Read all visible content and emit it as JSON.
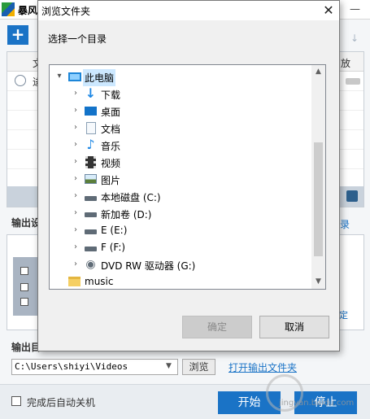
{
  "app": {
    "title": "暴风",
    "table_headers": [
      "文",
      "放"
    ],
    "first_cell": "进",
    "output_settings_label": "输出设",
    "right_link_top": "录",
    "right_link_bottom": "定",
    "output_dir_label": "输出目",
    "output_path": "C:\\Users\\shiyi\\Videos",
    "browse_label": "浏览",
    "open_folder_link": "打开输出文件夹",
    "shutdown_label": "完成后自动关机",
    "start_label": "开始",
    "stop_label": "停止"
  },
  "watermark": {
    "text": "jingyan.baidu.com"
  },
  "dialog": {
    "title": "浏览文件夹",
    "close_glyph": "✕",
    "prompt": "选择一个目录",
    "ok_label": "确定",
    "cancel_label": "取消",
    "tree": [
      {
        "label": "此电脑",
        "icon": "computer-icon",
        "expander": "▾",
        "selected": true
      },
      {
        "label": "下载",
        "icon": "download-folder-icon",
        "expander": "›"
      },
      {
        "label": "桌面",
        "icon": "desktop-folder-icon",
        "expander": "›"
      },
      {
        "label": "文档",
        "icon": "documents-folder-icon",
        "expander": "›"
      },
      {
        "label": "音乐",
        "icon": "music-folder-icon",
        "expander": "›"
      },
      {
        "label": "视频",
        "icon": "videos-folder-icon",
        "expander": "›"
      },
      {
        "label": "图片",
        "icon": "pictures-folder-icon",
        "expander": "›"
      },
      {
        "label": "本地磁盘 (C:)",
        "icon": "system-drive-icon",
        "expander": "›"
      },
      {
        "label": "新加卷 (D:)",
        "icon": "drive-icon",
        "expander": "›"
      },
      {
        "label": "E (E:)",
        "icon": "drive-icon",
        "expander": "›"
      },
      {
        "label": "F (F:)",
        "icon": "drive-icon",
        "expander": "›"
      },
      {
        "label": "DVD RW 驱动器 (G:)",
        "icon": "dvd-drive-icon",
        "expander": "›"
      },
      {
        "label": "music",
        "icon": "folder-icon",
        "expander": ""
      }
    ]
  },
  "colors": {
    "accent_blue": "#1a73c6",
    "selection": "#cce8ff",
    "dialog_bg": "#f0f0f0"
  }
}
